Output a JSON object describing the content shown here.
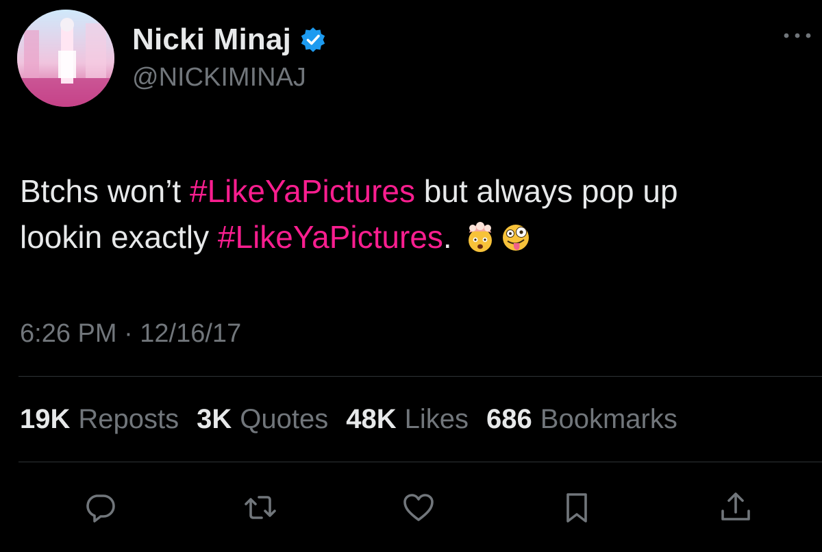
{
  "author": {
    "display_name": "Nicki Minaj",
    "handle": "@NICKIMINAJ",
    "verified": true
  },
  "tweet": {
    "segments_line1": [
      {
        "text": "Btchs won’t ",
        "kind": "text"
      },
      {
        "text": "#LikeYaPictures",
        "kind": "hashtag"
      },
      {
        "text": " but always pop up",
        "kind": "text"
      }
    ],
    "segments_line2": [
      {
        "text": "lookin exactly ",
        "kind": "text"
      },
      {
        "text": "#LikeYaPictures",
        "kind": "hashtag"
      },
      {
        "text": ". ",
        "kind": "text"
      }
    ],
    "emojis": [
      "exploding-head-emoji",
      "zany-face-emoji"
    ]
  },
  "timestamp": "6:26 PM · 12/16/17",
  "stats": [
    {
      "count": "19K",
      "label": "Reposts"
    },
    {
      "count": "3K",
      "label": "Quotes"
    },
    {
      "count": "48K",
      "label": "Likes"
    },
    {
      "count": "686",
      "label": "Bookmarks"
    }
  ],
  "actions": [
    "reply-icon",
    "repost-icon",
    "like-icon",
    "bookmark-icon",
    "share-icon"
  ],
  "colors": {
    "background": "#000000",
    "primary_text": "#e7e9ea",
    "secondary_text": "#71767b",
    "hashtag": "#f91e8f",
    "verified_badge": "#1d9bf0",
    "divider": "#2f3336"
  }
}
